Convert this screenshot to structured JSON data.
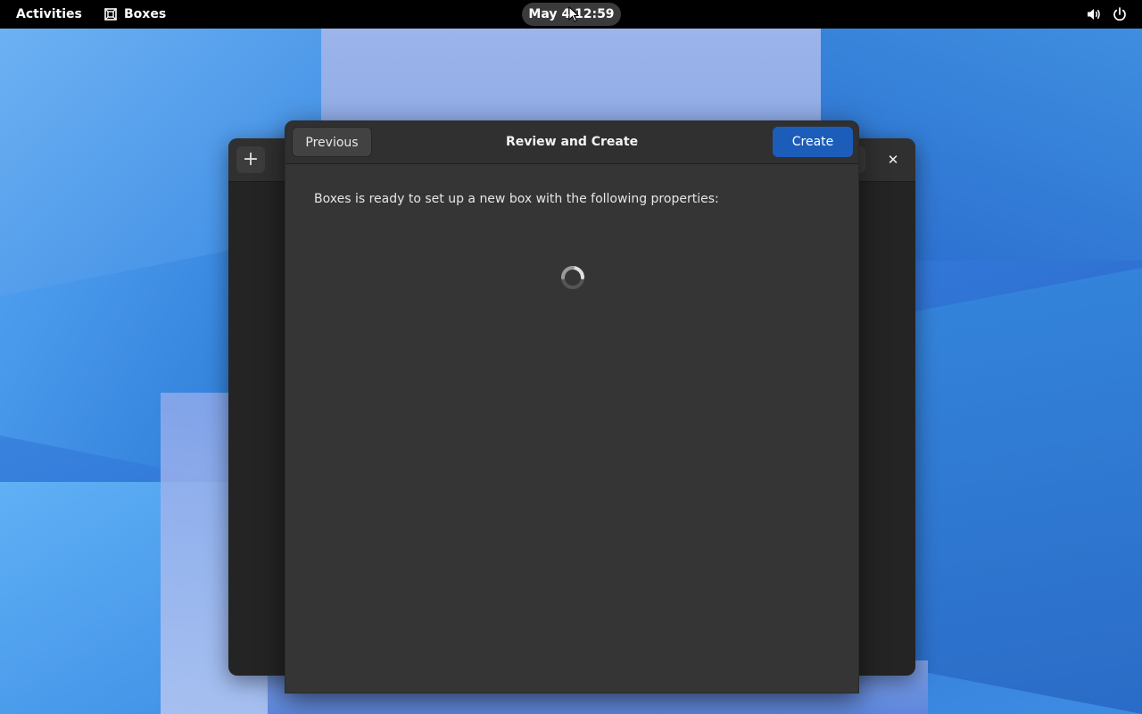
{
  "topbar": {
    "activities_label": "Activities",
    "app_name": "Boxes",
    "app_icon": "boxes-icon",
    "clock": "May 4 12:59",
    "status_icons": [
      "volume-icon",
      "power-icon"
    ]
  },
  "back_window": {
    "add_icon": "plus-icon",
    "close_icon": "close-icon"
  },
  "dialog": {
    "previous_label": "Previous",
    "title": "Review and Create",
    "create_label": "Create",
    "message": "Boxes is ready to set up a new box with the following properties:",
    "loading_icon": "spinner-icon"
  },
  "colors": {
    "accent": "#1c5dba",
    "dialog_bg": "#353535",
    "header_bg": "#303030",
    "topbar_bg": "#000000"
  }
}
